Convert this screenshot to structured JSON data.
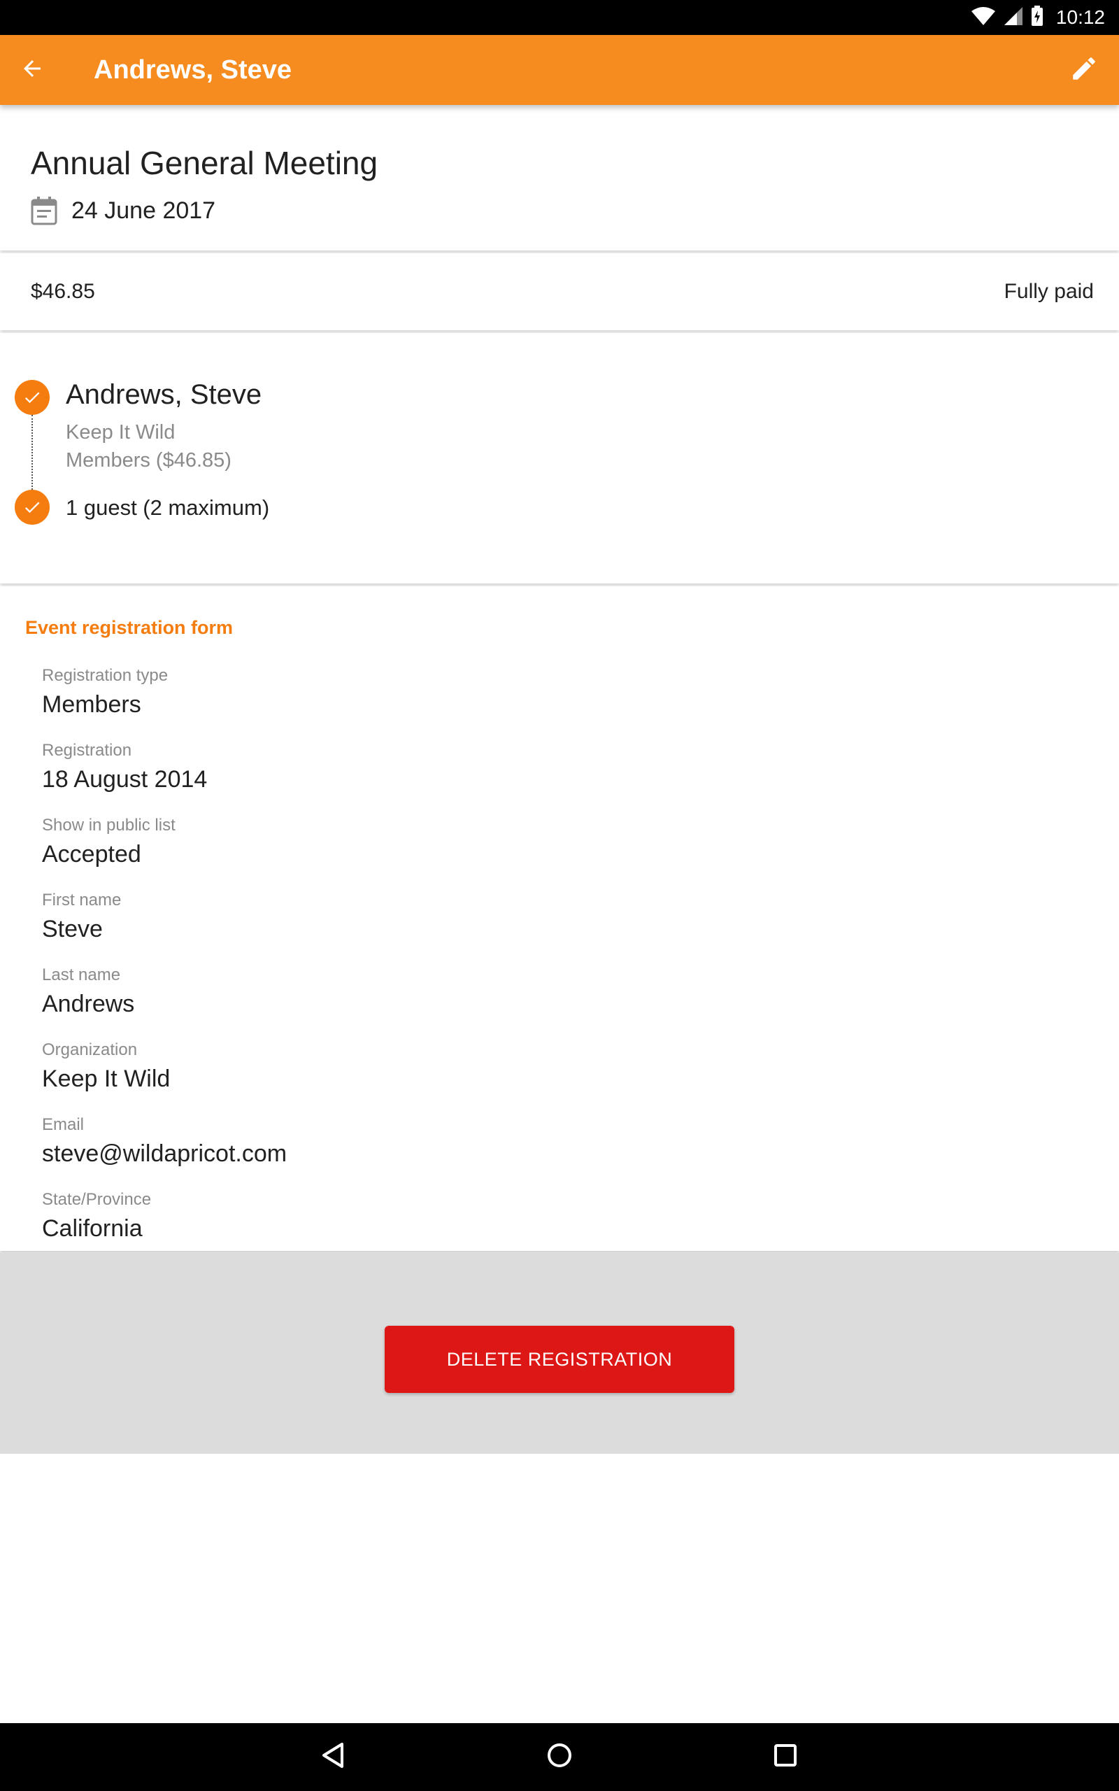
{
  "status_bar": {
    "time": "10:12"
  },
  "app_bar": {
    "title": "Andrews, Steve",
    "back_icon": "arrow-back-icon",
    "edit_icon": "pencil-icon"
  },
  "event": {
    "title": "Annual General Meeting",
    "date": "24 June 2017",
    "date_icon": "calendar-icon"
  },
  "payment": {
    "amount": "$46.85",
    "status": "Fully paid"
  },
  "registrant": {
    "name": "Andrews, Steve",
    "organization": "Keep It Wild",
    "registration_type": "Members ($46.85)",
    "guests": "1 guest (2 maximum)"
  },
  "form": {
    "heading": "Event registration form",
    "fields": [
      {
        "label": "Registration type",
        "value": "Members"
      },
      {
        "label": "Registration",
        "value": "18 August 2014"
      },
      {
        "label": "Show in public list",
        "value": "Accepted"
      },
      {
        "label": "First name",
        "value": "Steve"
      },
      {
        "label": "Last name",
        "value": "Andrews"
      },
      {
        "label": "Organization",
        "value": "Keep It Wild"
      },
      {
        "label": "Email",
        "value": "steve@wildapricot.com"
      },
      {
        "label": "State/Province",
        "value": "California"
      }
    ]
  },
  "actions": {
    "delete_label": "DELETE REGISTRATION"
  },
  "colors": {
    "accent": "#f68b1f",
    "check": "#f57c0f",
    "danger": "#dd1616"
  }
}
